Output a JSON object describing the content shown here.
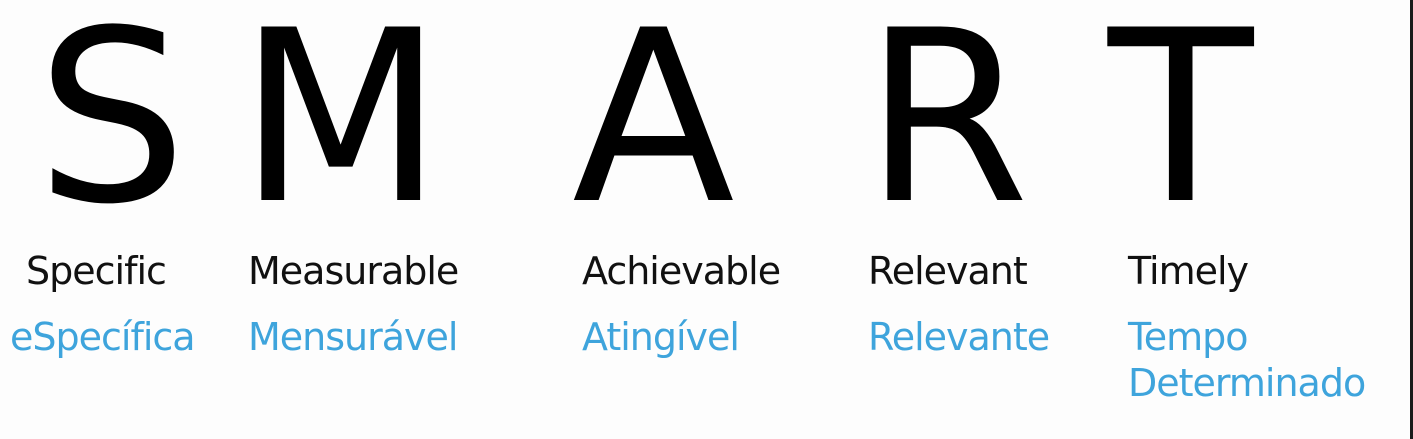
{
  "smart": [
    {
      "letter": "S",
      "english": "Specific",
      "portuguese": "eSpecífica"
    },
    {
      "letter": "M",
      "english": "Measurable",
      "portuguese": "Mensurável"
    },
    {
      "letter": "A",
      "english": "Achievable",
      "portuguese": "Atingível"
    },
    {
      "letter": "R",
      "english": "Relevant",
      "portuguese": "Relevante"
    },
    {
      "letter": "T",
      "english": "Timely",
      "portuguese": "Tempo Determinado"
    }
  ],
  "colors": {
    "letter": "#000000",
    "english": "#111111",
    "portuguese": "#3ea4dc",
    "background": "#fdfdfd"
  }
}
